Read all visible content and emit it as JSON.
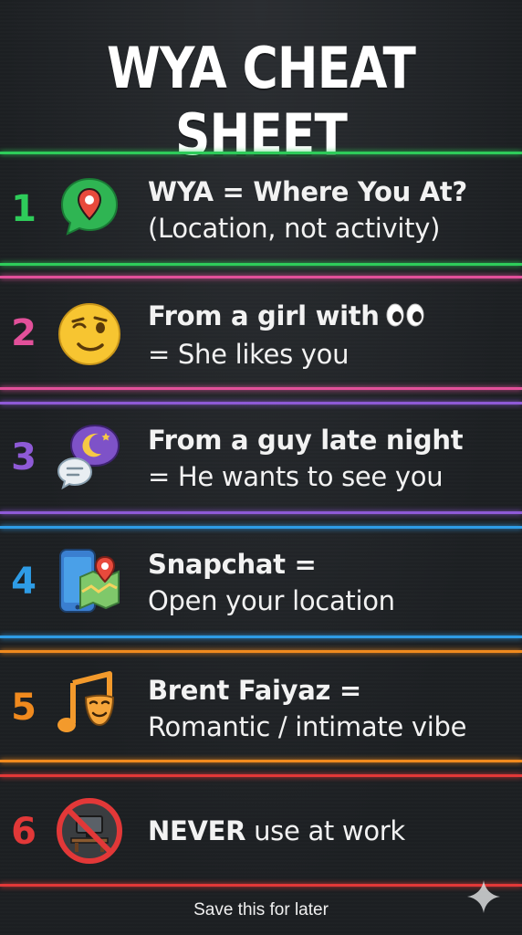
{
  "title": "WYA CHEAT SHEET",
  "colors": {
    "background": "#1f2225",
    "green": "#2ecc5a",
    "pink": "#e2509a",
    "purple": "#8e5ad6",
    "blue": "#2e9ce6",
    "orange": "#f08a1e",
    "red": "#e23838"
  },
  "items": [
    {
      "number": "1",
      "icon": "map-pin-chat-icon",
      "line1": "WYA = Where You At?",
      "line2": "(Location, not activity)"
    },
    {
      "number": "2",
      "icon": "winking-face-icon",
      "line1": "From a girl with",
      "line1_suffix_icon": "eyes-emoji-icon",
      "line2": "= She likes you"
    },
    {
      "number": "3",
      "icon": "night-chat-icon",
      "line1": "From a guy late night",
      "line2": "= He wants to see you"
    },
    {
      "number": "4",
      "icon": "phone-map-icon",
      "line1": "Snapchat =",
      "line2": "Open your location"
    },
    {
      "number": "5",
      "icon": "music-note-mask-icon",
      "line1": "Brent Faiyaz =",
      "line2": "Romantic / intimate vibe"
    },
    {
      "number": "6",
      "icon": "no-work-icon",
      "line1_bold": "NEVER",
      "line1_rest": " use at work"
    }
  ],
  "footer": "Save this for later",
  "sparkle_icon": "sparkle-icon"
}
